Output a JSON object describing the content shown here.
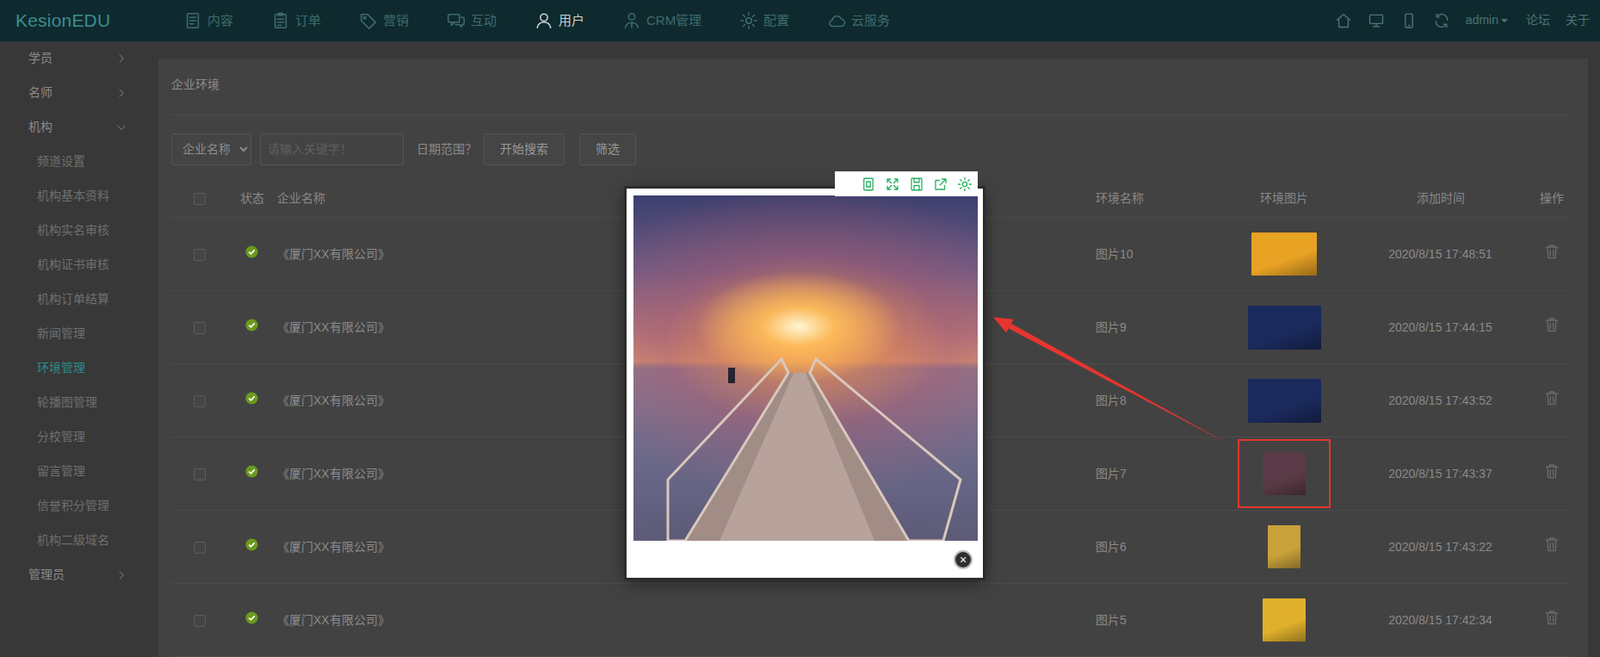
{
  "logo": "KesionEDU",
  "top_nav": [
    {
      "label": "内容",
      "selected": false
    },
    {
      "label": "订单",
      "selected": false
    },
    {
      "label": "营销",
      "selected": false
    },
    {
      "label": "互动",
      "selected": false
    },
    {
      "label": "用户",
      "selected": true
    },
    {
      "label": "CRM管理",
      "selected": false
    },
    {
      "label": "配置",
      "selected": false
    },
    {
      "label": "云服务",
      "selected": false
    }
  ],
  "top_right": {
    "user": "admin",
    "links": [
      "论坛",
      "关于"
    ]
  },
  "sidebar": {
    "groups": [
      {
        "label": "学员",
        "expanded": false,
        "items": []
      },
      {
        "label": "名师",
        "expanded": false,
        "items": []
      },
      {
        "label": "机构",
        "expanded": true,
        "items": [
          {
            "label": "频道设置",
            "selected": false
          },
          {
            "label": "机构基本资料",
            "selected": false
          },
          {
            "label": "机构实名审核",
            "selected": false
          },
          {
            "label": "机构证书审核",
            "selected": false
          },
          {
            "label": "机构订单结算",
            "selected": false
          },
          {
            "label": "新闻管理",
            "selected": false
          },
          {
            "label": "环境管理",
            "selected": true
          },
          {
            "label": "轮播图管理",
            "selected": false
          },
          {
            "label": "分校管理",
            "selected": false
          },
          {
            "label": "留言管理",
            "selected": false
          },
          {
            "label": "信誉积分管理",
            "selected": false
          },
          {
            "label": "机构二级域名",
            "selected": false
          }
        ]
      },
      {
        "label": "管理员",
        "expanded": false,
        "items": []
      }
    ]
  },
  "breadcrumb": "企业环境",
  "filter": {
    "field": "企业名称",
    "placeholder": "请输入关键字！",
    "date_label": "日期范围？",
    "buttons": [
      "开始搜索",
      "筛选"
    ]
  },
  "table": {
    "header_checked": false,
    "columns": [
      "状态",
      "企业名称",
      "环境名称",
      "环境图片",
      "添加时间",
      "操作"
    ],
    "rows": [
      {
        "checked": false,
        "enabled": true,
        "company": "《厦门XX有限公司》",
        "name": "图片10",
        "image_color": "#e8a224",
        "highlighted": false,
        "time": "2020/8/15 17:48:51"
      },
      {
        "checked": false,
        "enabled": true,
        "company": "《厦门XX有限公司》",
        "name": "图片9",
        "image_color": "#1b2a5c",
        "highlighted": false,
        "time": "2020/8/15 17:44:15"
      },
      {
        "checked": false,
        "enabled": true,
        "company": "《厦门XX有限公司》",
        "name": "图片8",
        "image_color": "#1b2a5c",
        "highlighted": false,
        "time": "2020/8/15 17:43:52"
      },
      {
        "checked": false,
        "enabled": true,
        "company": "《厦门XX有限公司》",
        "name": "图片7",
        "image_color": "#5a3a46",
        "highlighted": true,
        "time": "2020/8/15 17:43:37"
      },
      {
        "checked": false,
        "enabled": true,
        "company": "《厦门XX有限公司》",
        "name": "图片6",
        "image_color": "#c9a13a",
        "highlighted": false,
        "time": "2020/8/15 17:43:22"
      },
      {
        "checked": false,
        "enabled": true,
        "company": "《厦门XX有限公司》",
        "name": "图片5",
        "image_color": "#e0b02c",
        "highlighted": false,
        "time": "2020/8/15 17:42:34"
      }
    ]
  },
  "viewer": {
    "open": true,
    "close": "×"
  }
}
